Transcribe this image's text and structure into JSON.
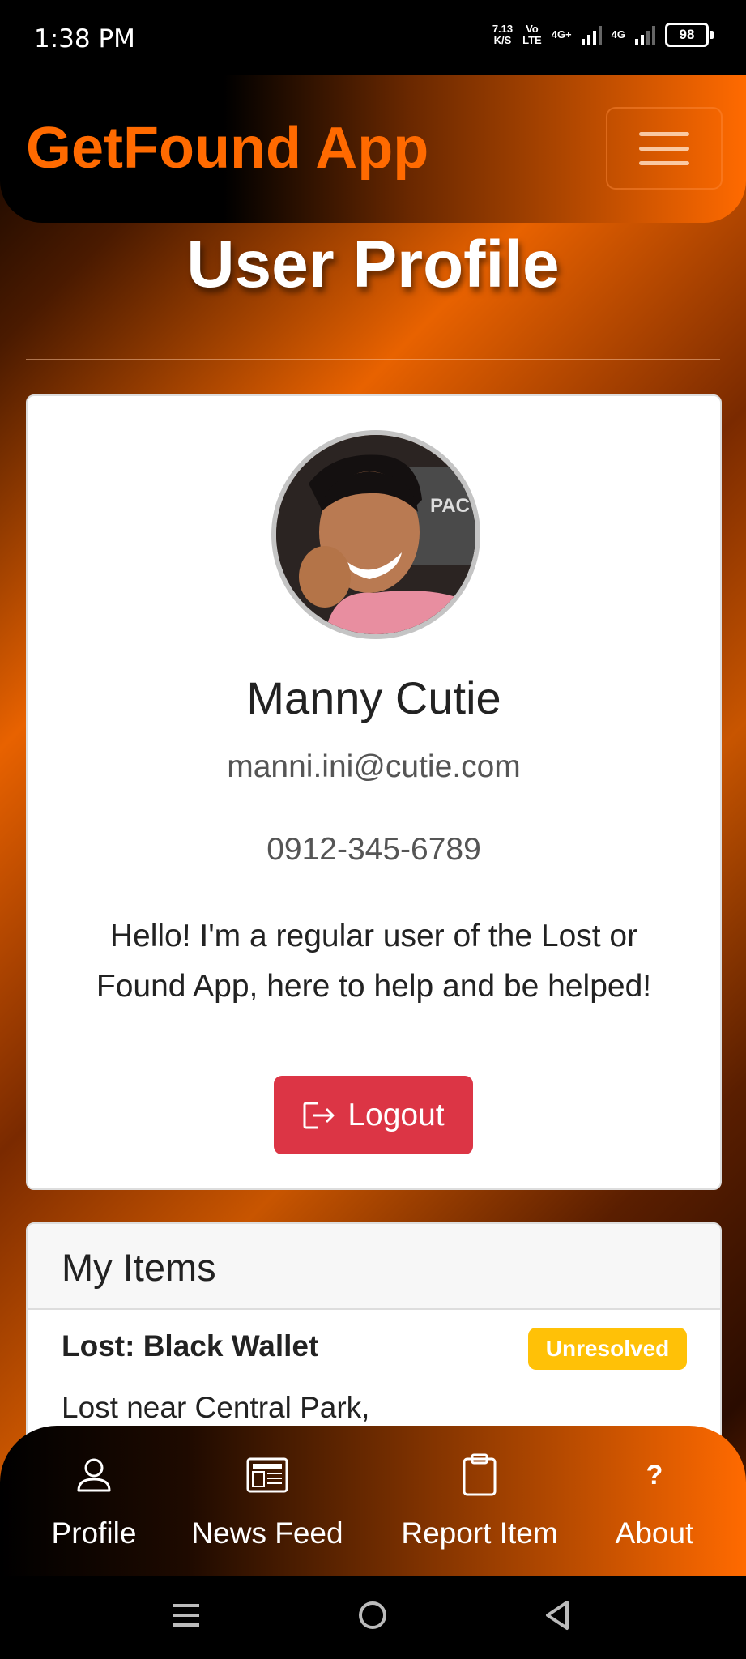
{
  "status_bar": {
    "time": "1:38 PM",
    "net_speed_value": "7.13",
    "net_speed_unit": "K/S",
    "volte_top": "Vo",
    "volte_bottom": "LTE",
    "sim1_type": "4G+",
    "sim2_type": "4G",
    "battery": "98"
  },
  "navbar": {
    "brand": "GetFound App",
    "menu_icon": "hamburger-menu-icon"
  },
  "page": {
    "title": "User Profile"
  },
  "profile": {
    "name": "Manny Cutie",
    "email": "manni.ini@cutie.com",
    "phone": "0912-345-6789",
    "bio": "Hello! I'm a regular user of the Lost or Found App, here to help and be helped!",
    "logout_label": "Logout",
    "logout_icon": "logout-icon"
  },
  "my_items": {
    "title": "My Items",
    "items": [
      {
        "title": "Lost: Black Wallet",
        "status": "Unresolved",
        "description": "Lost near Central Park,"
      }
    ]
  },
  "bottom_nav": {
    "items": [
      {
        "label": "Profile",
        "icon": "person-icon"
      },
      {
        "label": "News Feed",
        "icon": "newspaper-icon"
      },
      {
        "label": "Report Item",
        "icon": "clipboard-icon"
      },
      {
        "label": "About",
        "icon": "question-icon"
      }
    ]
  },
  "colors": {
    "brand_orange": "#ff6a00",
    "danger": "#dc3545",
    "warning": "#ffc107"
  }
}
